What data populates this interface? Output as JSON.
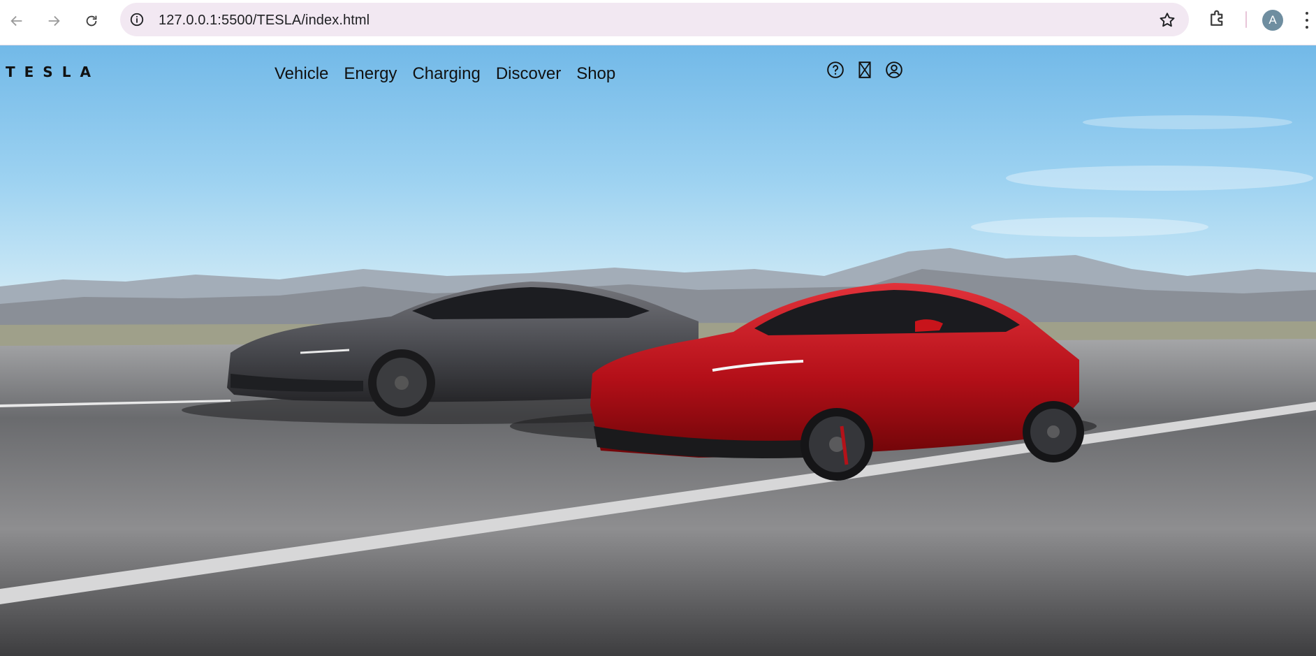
{
  "browser": {
    "url": "127.0.0.1:5500/TESLA/index.html",
    "profile_initial": "A",
    "icons": [
      "back-arrow-icon",
      "forward-arrow-icon",
      "reload-icon",
      "site-info-icon",
      "bookmark-star-icon",
      "extensions-icon",
      "more-menu-icon"
    ]
  },
  "site": {
    "logo": "TESLA",
    "nav": [
      "Vehicle",
      "Energy",
      "Charging",
      "Discover",
      "Shop"
    ],
    "utility_icons": [
      "help-icon",
      "language-icon",
      "account-icon"
    ]
  },
  "colors": {
    "omnibox": "#f2e8f2",
    "sky": "#9dd2f1",
    "red_car": "#c0141c",
    "gray_car": "#4a4b50"
  }
}
